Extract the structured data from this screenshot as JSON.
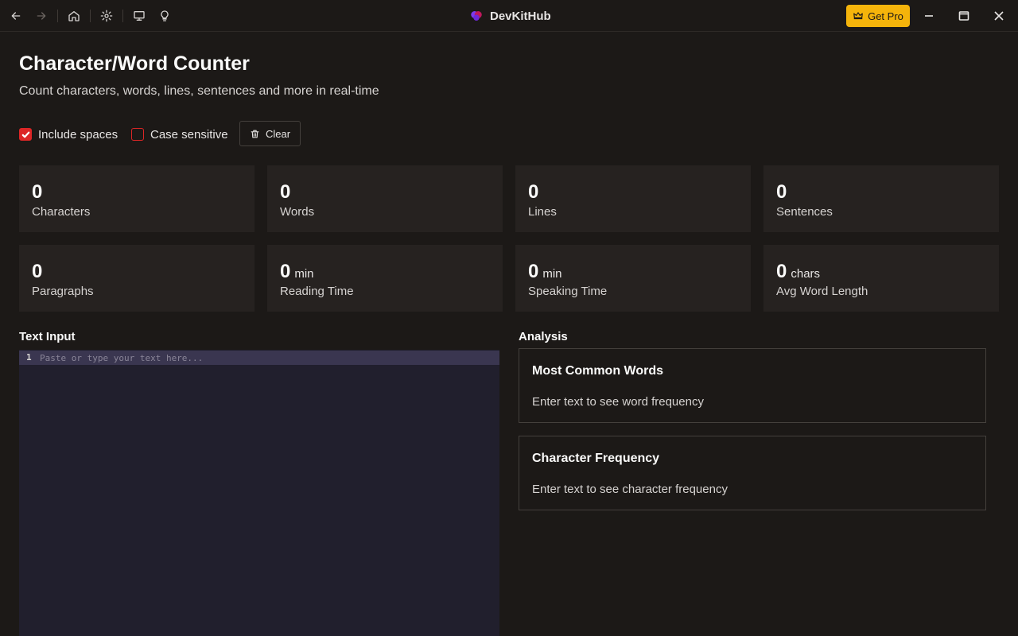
{
  "window": {
    "title": "DevKitHub",
    "get_pro_label": "Get Pro",
    "accent": "#f5b40b"
  },
  "toolbar_icons": [
    "back-arrow-icon",
    "forward-arrow-icon",
    "home-icon",
    "gear-icon",
    "monitor-icon",
    "lightbulb-icon"
  ],
  "page": {
    "title": "Character/Word Counter",
    "subtitle": "Count characters, words, lines, sentences and more in real-time"
  },
  "options": {
    "include_spaces": {
      "label": "Include spaces",
      "checked": true
    },
    "case_sensitive": {
      "label": "Case sensitive",
      "checked": false
    },
    "clear_label": "Clear"
  },
  "stats": [
    {
      "value": "0",
      "unit": "",
      "label": "Characters"
    },
    {
      "value": "0",
      "unit": "",
      "label": "Words"
    },
    {
      "value": "0",
      "unit": "",
      "label": "Lines"
    },
    {
      "value": "0",
      "unit": "",
      "label": "Sentences"
    },
    {
      "value": "0",
      "unit": "",
      "label": "Paragraphs"
    },
    {
      "value": "0",
      "unit": "min",
      "label": "Reading Time"
    },
    {
      "value": "0",
      "unit": "min",
      "label": "Speaking Time"
    },
    {
      "value": "0",
      "unit": "chars",
      "label": "Avg Word Length"
    }
  ],
  "input": {
    "label": "Text Input",
    "line_number": "1",
    "placeholder": "Paste or type your text here...",
    "value": ""
  },
  "analysis": {
    "label": "Analysis",
    "common_words": {
      "title": "Most Common Words",
      "message": "Enter text to see word frequency"
    },
    "char_frequency": {
      "title": "Character Frequency",
      "message": "Enter text to see character frequency"
    }
  },
  "colors": {
    "background": "#1c1917",
    "card": "#262220",
    "checkbox": "#dc2626",
    "editor": "#211f2d"
  }
}
